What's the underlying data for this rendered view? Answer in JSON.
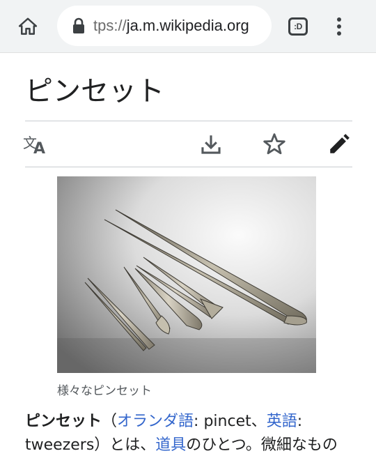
{
  "browser": {
    "url_scheme": "tps://",
    "url_host": "ja.m.wikipedia.org",
    "tab_switcher_label": ":D"
  },
  "article": {
    "title": "ピンセット",
    "image_caption": "様々なピンセット",
    "intro": {
      "term": "ピンセット",
      "open_paren": "（",
      "link_dutch": "オランダ語",
      "text_dutch": ": pincet、",
      "link_english": "英語",
      "text_english": ":",
      "text_tweezers": "tweezers）とは、",
      "link_tool": "道具",
      "text_rest": "のひとつ。微細なもの"
    }
  },
  "colors": {
    "link": "#3366cc",
    "chrome_bg": "#f1f3f4",
    "icon": "#54595d"
  }
}
